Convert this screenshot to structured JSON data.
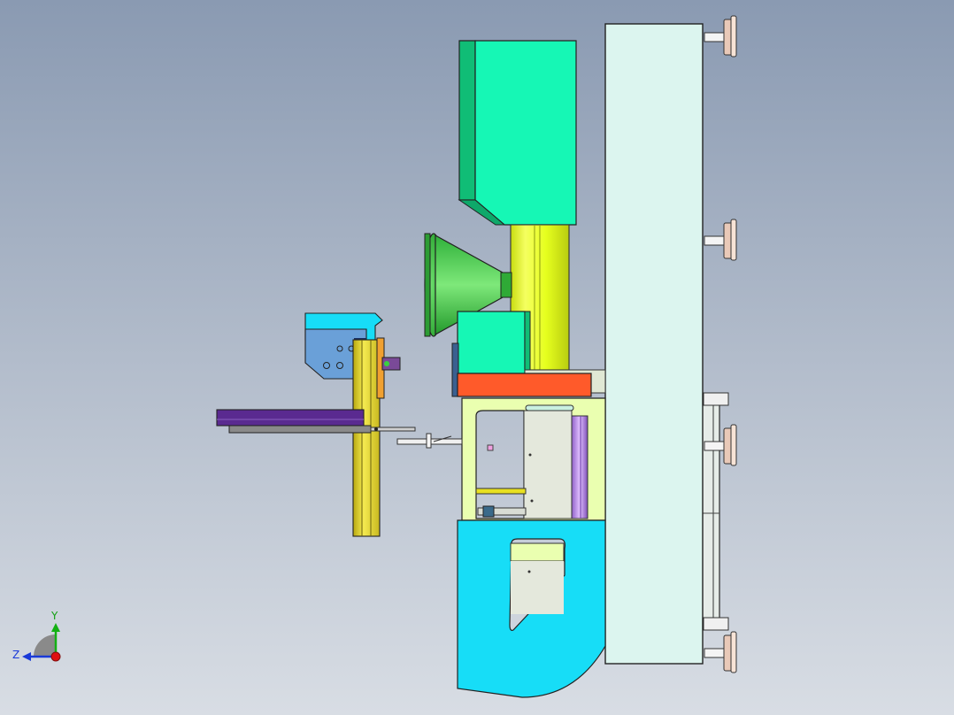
{
  "viewport": {
    "background_top": "#8a9ab2",
    "background_bottom": "#d8dde4"
  },
  "triad": {
    "y_label": "Y",
    "z_label": "Z",
    "y_color": "#13b013",
    "z_color": "#1a3ad8",
    "origin_color": "#e01010"
  },
  "colors": {
    "panel": "#dcf5ef",
    "mint": "#16f7b5",
    "mint_dark": "#10bd76",
    "yellow_column": "#e6ff1e",
    "funnel": "#35c23a",
    "orange": "#ff5a2a",
    "lime_frame": "#eaffb0",
    "cyan": "#17ddf7",
    "sky": "#6aa0d8",
    "purple": "#5a2a90",
    "yellow_rail": "#e8d82a",
    "orange_bracket": "#f0a030",
    "violet_rod": "#c08ae8",
    "foot": "#e9c9b8"
  }
}
